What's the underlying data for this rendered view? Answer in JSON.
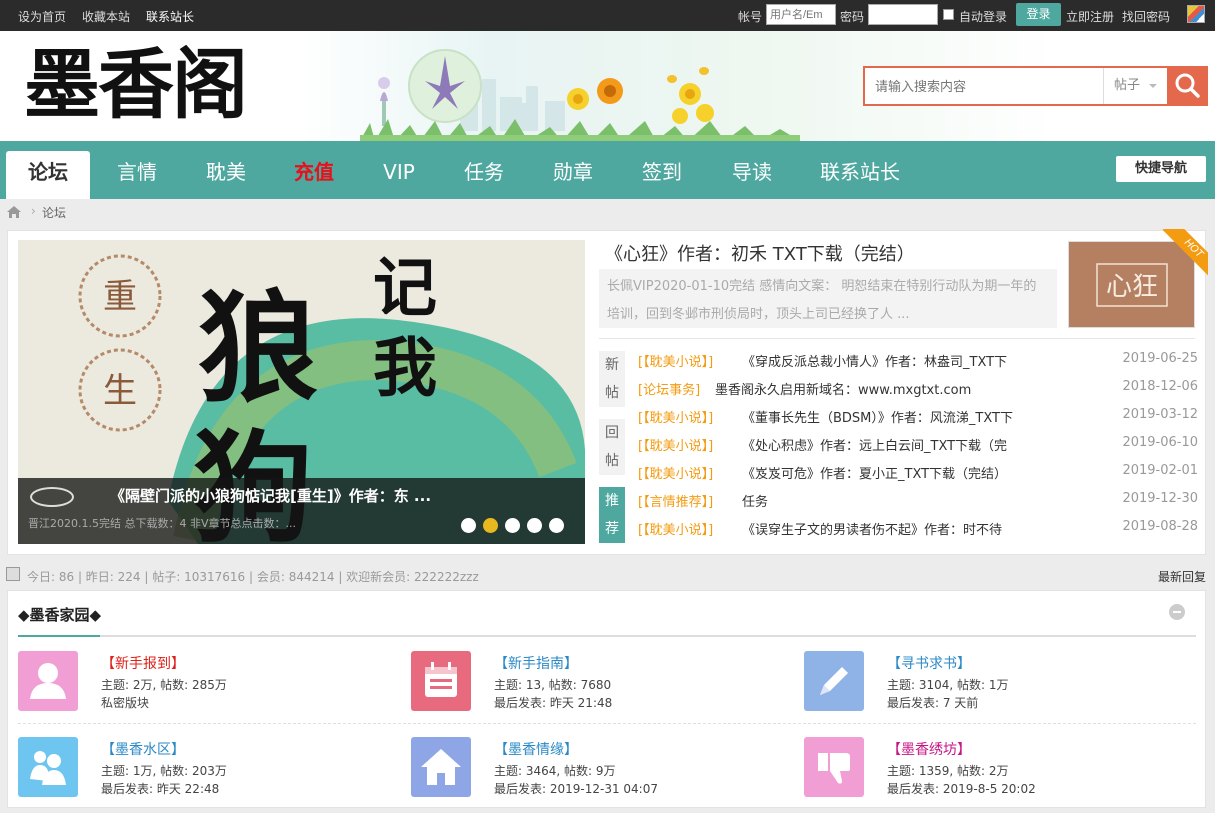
{
  "topbar": {
    "links": [
      "设为首页",
      "收藏本站",
      "联系站长"
    ],
    "account_label": "帐号",
    "account_placeholder": "用户名/Em",
    "password_label": "密码",
    "auto_login_label": "自动登录",
    "login_button": "登录",
    "register_link": "立即注册",
    "recover_link": "找回密码"
  },
  "header": {
    "logo_text": "墨香阁",
    "search_placeholder": "请输入搜索内容",
    "search_type": "帖子"
  },
  "nav": {
    "items": [
      "论坛",
      "言情",
      "耽美",
      "充值",
      "VIP",
      "任务",
      "勋章",
      "签到",
      "导读",
      "联系站长"
    ],
    "quick_nav": "快捷导航"
  },
  "breadcrumb": {
    "current": "论坛"
  },
  "slideshow": {
    "title": "《隔壁门派的小狼狗惦记我[重生]》作者：东 ...",
    "subtitle": "晋江2020.1.5完结 总下载数：4 非V章节总点击数：...",
    "seal_top": "重",
    "seal_bottom": "生",
    "art_text_big": "狼",
    "art_text_big2": "狗",
    "art_text_right1": "记",
    "art_text_right2": "我",
    "active_index": 1,
    "count": 5
  },
  "hot": {
    "title": "《心狂》作者：初禾 TXT下载（完结）",
    "summary": "长佩VIP2020-01-10完结 感情向文案： 明恕结束在特别行动队为期一年的培训，回到冬邺市刑侦局时，顶头上司已经换了人 ...",
    "thumb_text": "心狂",
    "badge": "HOT"
  },
  "tabs": {
    "new_posts": [
      "新",
      "帖"
    ],
    "replies": [
      "回",
      "帖"
    ],
    "recommend": [
      "推",
      "荐"
    ]
  },
  "posts": [
    {
      "category": "[【耽美小说】]",
      "title": "《穿成反派总裁小情人》作者：林盎司_TXT下",
      "date": "2019-06-25"
    },
    {
      "category": "[论坛事务]",
      "title": "墨香阁永久启用新域名：www.mxgtxt.com",
      "date": "2018-12-06"
    },
    {
      "category": "[【耽美小说】]",
      "title": "《董事长先生（BDSM）》作者：风流涕_TXT下",
      "date": "2019-03-12"
    },
    {
      "category": "[【耽美小说】]",
      "title": "《处心积虑》作者：远上白云间_TXT下载（完",
      "date": "2019-06-10"
    },
    {
      "category": "[【耽美小说】]",
      "title": "《岌岌可危》作者：夏小正_TXT下载（完结）",
      "date": "2019-02-01"
    },
    {
      "category": "[【言情推荐】]",
      "title": "任务",
      "date": "2019-12-30"
    },
    {
      "category": "[【耽美小说】]",
      "title": "《误穿生子文的男读者伤不起》作者：时不待",
      "date": "2019-08-28"
    }
  ],
  "stats": {
    "text": "今日: 86 | 昨日: 224 | 帖子: 10317616 | 会员: 844214 | 欢迎新会员: 222222zzz",
    "latest_reply": "最新回复"
  },
  "forum": {
    "section_title": "◆墨香家园◆",
    "boards": [
      {
        "name": "【新手报到】",
        "line1": "主题: 2万, 帖数: 285万",
        "line2": "私密版块",
        "icon": "user-icon",
        "color": "#f19ed4",
        "name_color": "#e0211b"
      },
      {
        "name": "【新手指南】",
        "line1": "主题: 13, 帖数: 7680",
        "line2": "最后发表: 昨天 21:48",
        "icon": "calendar-icon",
        "color": "#e86a7e",
        "name_color": "#2b8ac6"
      },
      {
        "name": "【寻书求书】",
        "line1": "主题: 3104, 帖数: 1万",
        "line2": "最后发表: 7 天前",
        "icon": "pencil-icon",
        "color": "#8fb3e6",
        "name_color": "#2b8ac6"
      },
      {
        "name": "【墨香水区】",
        "line1": "主题: 1万, 帖数: 203万",
        "line2": "最后发表: 昨天 22:48",
        "icon": "people-icon",
        "color": "#6ec6f0",
        "name_color": "#2b8ac6"
      },
      {
        "name": "【墨香情缘】",
        "line1": "主题: 3464, 帖数: 9万",
        "line2": "最后发表: 2019-12-31 04:07",
        "icon": "house-icon",
        "color": "#8fa6e6",
        "name_color": "#2b8ac6"
      },
      {
        "name": "【墨香绣坊】",
        "line1": "主题: 1359, 帖数: 2万",
        "line2": "最后发表: 2019-8-5 20:02",
        "icon": "dislike-icon",
        "color": "#f19ed4",
        "name_color": "#c71585"
      }
    ]
  }
}
